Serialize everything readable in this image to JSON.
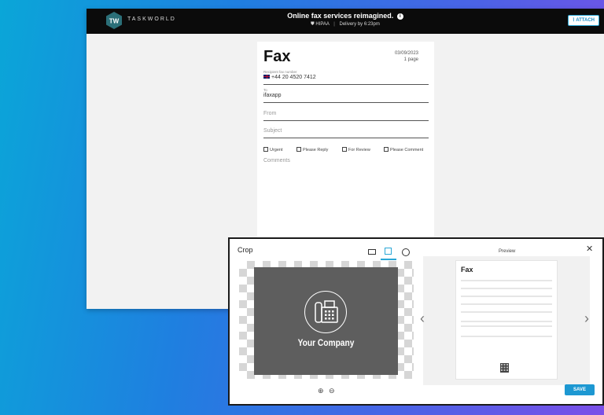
{
  "brand": {
    "name": "TASKWORLD"
  },
  "header": {
    "tagline": "Online fax services reimagined.",
    "hipaa": "HIPAA",
    "delivery": "Delivery by 6:23pm",
    "attach_label": "ATTACH"
  },
  "fax": {
    "title": "Fax",
    "date": "03/09/2023",
    "pages": "1 page",
    "recipient_label": "Recipient fax number",
    "recipient_value": "+44 20 4520 7412",
    "to_label": "To",
    "to_value": "ifaxapp",
    "from_placeholder": "From",
    "subject_placeholder": "Subject",
    "checkboxes": [
      "Urgent",
      "Please Reply",
      "For Review",
      "Please Comment"
    ],
    "comments_placeholder": "Comments"
  },
  "crop_dialog": {
    "title": "Crop",
    "image_text": "Your Company",
    "preview_label": "Preview",
    "preview_title": "Fax",
    "save_label": "SAVE",
    "close_label": "✕"
  },
  "colors": {
    "accent": "#1d98d2",
    "topbar": "#0b0b0b",
    "crop_image_bg": "#5e5e5e"
  }
}
